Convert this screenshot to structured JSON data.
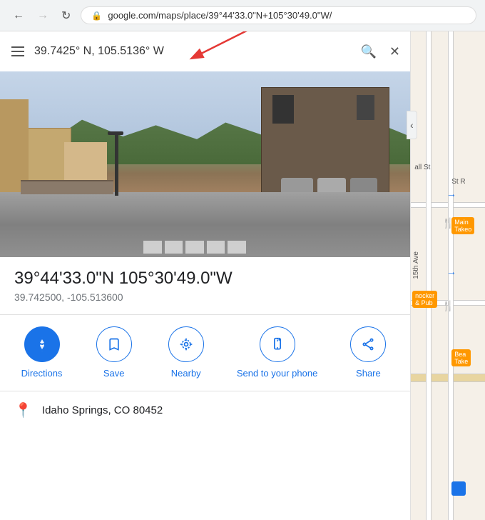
{
  "browser": {
    "url": "google.com/maps/place/39°44'33.0\"N+105°30'49.0\"W/",
    "back_label": "←",
    "forward_label": "→",
    "reload_label": "↻"
  },
  "search": {
    "query": "39.7425° N, 105.5136° W",
    "hamburger_label": "☰",
    "search_icon": "🔍",
    "close_icon": "✕",
    "collapse_icon": "‹"
  },
  "location": {
    "dms": "39°44'33.0\"N 105°30'49.0\"W",
    "decimal": "39.742500, -105.513600",
    "address": "Idaho Springs, CO 80452",
    "pin_icon": "📍"
  },
  "actions": [
    {
      "id": "directions",
      "icon": "⬡",
      "label": "Directions",
      "filled": true
    },
    {
      "id": "save",
      "icon": "🔖",
      "label": "Save",
      "filled": false
    },
    {
      "id": "nearby",
      "icon": "📍",
      "label": "Nearby",
      "filled": false
    },
    {
      "id": "send-to-phone",
      "icon": "📱",
      "label": "Send to your phone",
      "filled": false
    },
    {
      "id": "share",
      "icon": "⤴",
      "label": "Share",
      "filled": false
    }
  ],
  "map": {
    "road_labels": [
      "15th Ave",
      "St R",
      "all St"
    ],
    "poi_labels": [
      "Main\nTakeo",
      "nocker\n& Pub",
      "Bea\nTake"
    ],
    "green_icon": "🍴",
    "fork_icon": "⑁"
  }
}
